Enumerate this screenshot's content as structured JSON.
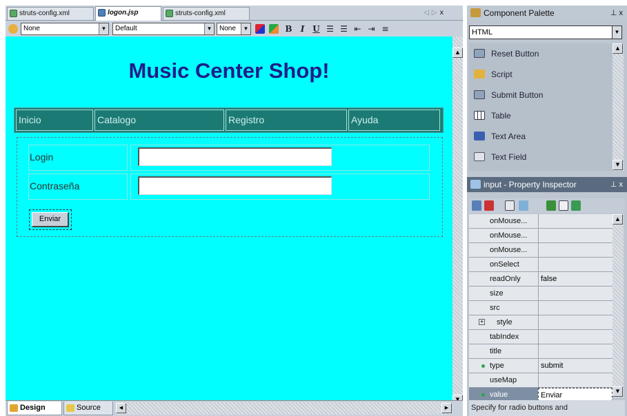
{
  "editor": {
    "tabs": [
      {
        "label": "struts-config.xml",
        "active": false,
        "icon": "xml-file-icon"
      },
      {
        "label": "logon.jsp",
        "active": true,
        "icon": "jsp-file-icon"
      },
      {
        "label": "struts-config.xml",
        "active": false,
        "icon": "xml-file-icon"
      }
    ],
    "close_glyph": "x",
    "format_toolbar": {
      "paragraph_style": "None",
      "font_family": "Default",
      "font_size": "None",
      "buttons": [
        "B",
        "I",
        "U"
      ]
    },
    "design_page": {
      "title": "Music Center Shop!",
      "nav_items": [
        "Inicio",
        "Catalogo",
        "Registro",
        "Ayuda"
      ],
      "login_label": "Login",
      "password_label": "Contraseña",
      "login_value": "",
      "password_value": "",
      "submit_label": "Enviar"
    },
    "bottom_tabs": [
      {
        "label": "Design",
        "active": true
      },
      {
        "label": "Source",
        "active": false
      }
    ]
  },
  "palette": {
    "title": "Component Palette",
    "pin": "⊥ x",
    "page": "HTML",
    "items": [
      {
        "label": "Reset Button",
        "icon": "reset-button-icon"
      },
      {
        "label": "Script",
        "icon": "script-icon"
      },
      {
        "label": "Submit Button",
        "icon": "submit-button-icon"
      },
      {
        "label": "Table",
        "icon": "table-icon"
      },
      {
        "label": "Text Area",
        "icon": "text-area-icon"
      },
      {
        "label": "Text Field",
        "icon": "text-field-icon"
      }
    ]
  },
  "inspector": {
    "title": "input - Property Inspector",
    "pin": "⊥ x",
    "properties": [
      {
        "name": "onMouse...",
        "value": ""
      },
      {
        "name": "onMouse...",
        "value": ""
      },
      {
        "name": "onMouse...",
        "value": ""
      },
      {
        "name": "onSelect",
        "value": ""
      },
      {
        "name": "readOnly",
        "value": "false"
      },
      {
        "name": "size",
        "value": ""
      },
      {
        "name": "src",
        "value": ""
      },
      {
        "name": "style",
        "value": "",
        "expander": "+"
      },
      {
        "name": "tabIndex",
        "value": ""
      },
      {
        "name": "title",
        "value": ""
      },
      {
        "name": "type",
        "value": "submit",
        "set": true
      },
      {
        "name": "useMap",
        "value": ""
      },
      {
        "name": "value",
        "value": "Enviar",
        "set": true,
        "selected": true
      }
    ],
    "description": "Specify for radio buttons and"
  },
  "colors": {
    "canvas": "#00ffff",
    "title": "#1f1e8a",
    "nav_bg": "#1a7d75",
    "panel_header_dark": "#5a6b80"
  }
}
